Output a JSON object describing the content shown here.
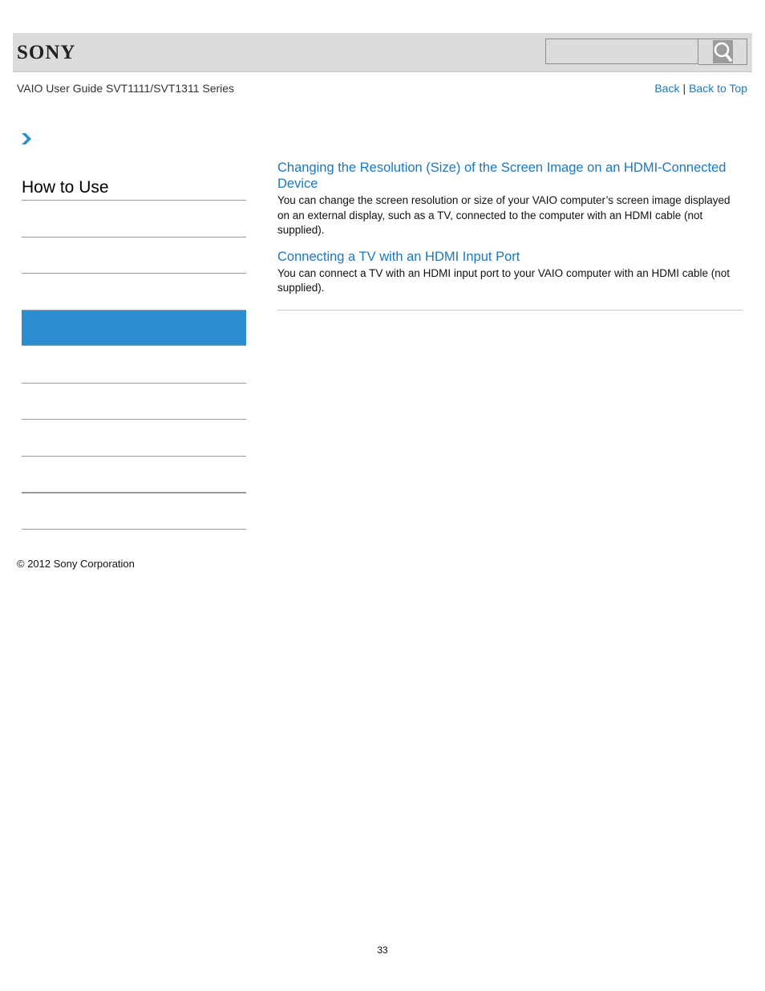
{
  "header": {
    "logo": "SONY",
    "search": {
      "placeholder": "",
      "value": "",
      "button_icon": "search-icon"
    }
  },
  "subheader": {
    "guide_title": "VAIO User Guide SVT1111/SVT1311 Series",
    "back_label": "Back",
    "separator": "|",
    "back_to_top_label": "Back to Top"
  },
  "breadcrumb": {
    "icon": "chevron-right-icon"
  },
  "sidebar": {
    "title": "How to Use",
    "items": [
      {
        "label": "",
        "active": false
      },
      {
        "label": "",
        "active": false
      },
      {
        "label": "",
        "active": true
      },
      {
        "label": "",
        "active": false
      },
      {
        "label": "",
        "active": false
      },
      {
        "label": "",
        "active": false
      },
      {
        "label": "",
        "active": false
      },
      {
        "label": "",
        "active": false
      }
    ]
  },
  "main": {
    "topics": [
      {
        "title": "Changing the Resolution (Size) of the Screen Image on an HDMI-Connected Device",
        "description": "You can change the screen resolution or size of your VAIO computer’s screen image displayed on an external display, such as a TV, connected to the computer with an HDMI cable (not supplied)."
      },
      {
        "title": "Connecting a TV with an HDMI Input Port",
        "description": "You can connect a TV with an HDMI input port to your VAIO computer with an HDMI cable (not supplied)."
      }
    ]
  },
  "footer": {
    "copyright": "© 2012 Sony Corporation",
    "page_number": "33"
  },
  "colors": {
    "link": "#1a78c2",
    "active_item": "#2a8dcd",
    "header_bg": "#dcdcdc"
  }
}
